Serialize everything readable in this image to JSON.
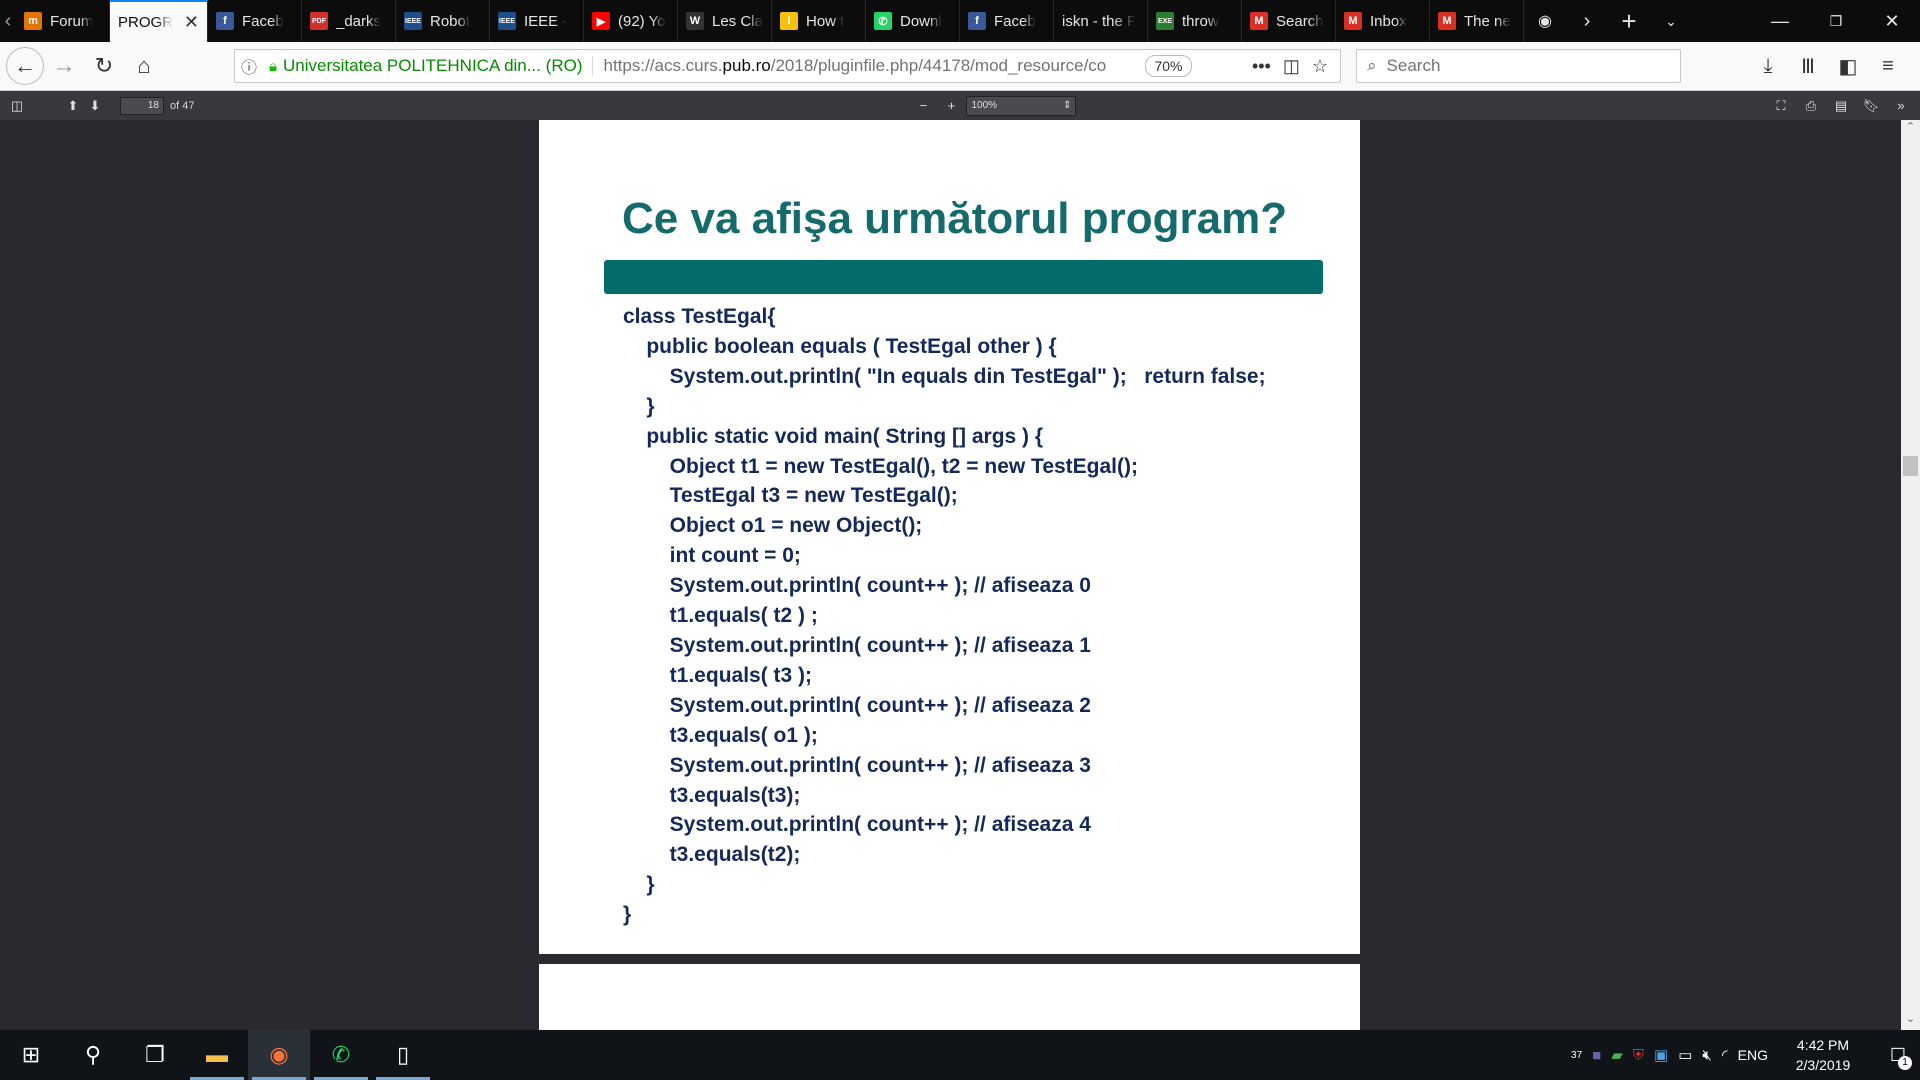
{
  "tabs": [
    {
      "label": "Forum",
      "icon": "m",
      "icon_color": "#e37400",
      "active": false
    },
    {
      "label": "PROGR",
      "icon": "",
      "icon_color": "",
      "active": true
    },
    {
      "label": "Faceb",
      "icon": "f",
      "icon_color": "#3b5998",
      "active": false
    },
    {
      "label": "_darks",
      "icon": "PDF",
      "icon_color": "#d0312d",
      "active": false
    },
    {
      "label": "Robot",
      "icon": "IEEE",
      "icon_color": "#1d4e89",
      "active": false
    },
    {
      "label": "IEEE -",
      "icon": "IEEE",
      "icon_color": "#1d4e89",
      "active": false
    },
    {
      "label": "(92) Yo",
      "icon": "▶",
      "icon_color": "#ff0000",
      "active": false
    },
    {
      "label": "Les Cla",
      "icon": "W",
      "icon_color": "#333333",
      "active": false
    },
    {
      "label": "How t",
      "icon": "i",
      "icon_color": "#f4c20d",
      "active": false
    },
    {
      "label": "Downl",
      "icon": "✆",
      "icon_color": "#25d366",
      "active": false
    },
    {
      "label": "Faceb",
      "icon": "f",
      "icon_color": "#3b5998",
      "active": false
    },
    {
      "label": "iskn - the F",
      "icon": "",
      "icon_color": "",
      "active": false
    },
    {
      "label": "throw",
      "icon": "EXE",
      "icon_color": "#2e7d32",
      "active": false
    },
    {
      "label": "Search",
      "icon": "M",
      "icon_color": "#d93025",
      "active": false
    },
    {
      "label": "Inbox",
      "icon": "M",
      "icon_color": "#d93025",
      "active": false
    },
    {
      "label": "The ne",
      "icon": "M",
      "icon_color": "#d93025",
      "active": false
    }
  ],
  "url": {
    "org": "Universitatea POLITEHNICA din... (RO)",
    "prefix": "https://acs.curs.",
    "domain": "pub.ro",
    "path": "/2018/pluginfile.php/44178/mod_resource/co",
    "zoom": "70%"
  },
  "search": {
    "placeholder": "Search"
  },
  "pdf": {
    "page_number": "18",
    "page_count": "of 47",
    "zoom": "100%"
  },
  "slide": {
    "title": "Ce va afişa următorul program?",
    "code": "class TestEgal{\n    public boolean equals ( TestEgal other ) {\n        System.out.println( \"In equals din TestEgal\" );   return false;\n    }\n    public static void main( String [] args ) {\n        Object t1 = new TestEgal(), t2 = new TestEgal();\n        TestEgal t3 = new TestEgal();\n        Object o1 = new Object();\n        int count = 0;\n        System.out.println( count++ ); // afiseaza 0\n        t1.equals( t2 ) ;\n        System.out.println( count++ ); // afiseaza 1\n        t1.equals( t3 );\n        System.out.println( count++ ); // afiseaza 2\n        t3.equals( o1 );\n        System.out.println( count++ ); // afiseaza 3\n        t3.equals(t3);\n        System.out.println( count++ ); // afiseaza 4\n        t3.equals(t2);\n    }\n}"
  },
  "taskbar": {
    "tray_count": "37",
    "language": "ENG",
    "time": "4:42 PM",
    "date": "2/3/2019",
    "notifications": "1"
  }
}
